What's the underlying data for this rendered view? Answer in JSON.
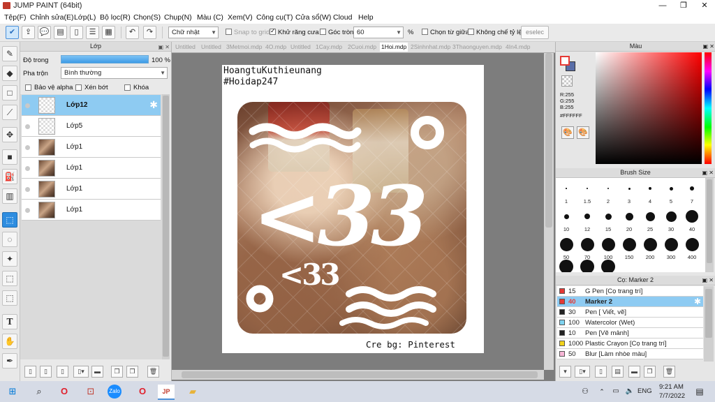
{
  "window": {
    "title": "JUMP PAINT (64bit)",
    "minimize": "—",
    "restore": "❐",
    "close": "✕"
  },
  "menu": [
    "Tệp(F)",
    "Chỉnh sửa(E)",
    "Lớp(L)",
    "Bộ lọc(R)",
    "Chọn(S)",
    "Chụp(N)",
    "Màu (C)",
    "Xem(V)",
    "Công cụ(T)",
    "Cửa sổ(W)",
    "Cloud",
    "Help"
  ],
  "toolbar": {
    "selection_shape": "Chữ nhật",
    "snap_to_grid": "Snap to grid",
    "antialias": "Khử răng cưa",
    "corner_label": "Góc tròn",
    "corner_value": "60",
    "percent": "%",
    "select_center": "Chọn từ giữa",
    "no_ratio": "Không chế tỷ lệ",
    "deselect": "eselec"
  },
  "layer_panel": {
    "title": "Lớp",
    "opacity_label": "Độ trong",
    "opacity_value": "100 %",
    "opacity_fill": 1.0,
    "blend_label": "Pha trộn",
    "blend_value": "Bình thường",
    "protect_alpha": "Bảo vệ alpha",
    "clip": "Xén bớt",
    "lock": "Khóa",
    "layers": [
      {
        "name": "Lớp12",
        "selected": true,
        "thumb": "transparent"
      },
      {
        "name": "Lớp5",
        "selected": false,
        "thumb": "transparent"
      },
      {
        "name": "Lớp1",
        "selected": false,
        "thumb": "image"
      },
      {
        "name": "Lớp1",
        "selected": false,
        "thumb": "image"
      },
      {
        "name": "Lớp1",
        "selected": false,
        "thumb": "image"
      },
      {
        "name": "Lớp1",
        "selected": false,
        "thumb": "image"
      }
    ]
  },
  "tabs": [
    "Untitled",
    "Untitled",
    "3Metmoi.mdp",
    "4O.mdp",
    "Untitled",
    "1Cay.mdp",
    "2Cuoi.mdp",
    "1Hoi.mdp",
    "2Sinhnhat.mdp",
    "3Thaonguyen.mdp",
    "4In4.mdp"
  ],
  "active_tab": 7,
  "canvas": {
    "header_line1": "HoangtuKuthieunang",
    "header_line2": "#Hoidap247",
    "big_text": "<33",
    "small_text": "<33",
    "credit": "Cre bg: Pinterest"
  },
  "color_panel": {
    "title": "Màu",
    "r": "R:255",
    "g": "G:255",
    "b": "B:255",
    "hex": "#FFFFFF",
    "primary_color": "#e53935",
    "secondary_color": "#5a6ea8"
  },
  "brush_panel": {
    "title": "Brush Size",
    "sizes": [
      "1",
      "1.5",
      "2",
      "3",
      "4",
      "5",
      "7",
      "10",
      "12",
      "15",
      "20",
      "25",
      "30",
      "40",
      "50",
      "70",
      "100",
      "150",
      "200",
      "300",
      "400"
    ]
  },
  "marker_panel": {
    "title": "Cọ: Marker 2",
    "items": [
      {
        "size": "15",
        "name": "G Pen [Cọ trang trí]",
        "color": "#e53935",
        "selected": false
      },
      {
        "size": "40",
        "name": "Marker 2",
        "color": "#e53935",
        "selected": true
      },
      {
        "size": "30",
        "name": "Pen [ Viết, vẽ]",
        "color": "#222222",
        "selected": false
      },
      {
        "size": "100",
        "name": "Watercolor (Wet)",
        "color": "#7fd3f0",
        "selected": false
      },
      {
        "size": "10",
        "name": "Pen [Vẽ mảnh]",
        "color": "#222222",
        "selected": false
      },
      {
        "size": "1000",
        "name": "Plastic Crayon [Cọ trang trí]",
        "color": "#f2d21b",
        "selected": false
      },
      {
        "size": "50",
        "name": "Blur [Làm nhòe màu]",
        "color": "#f7b6d6",
        "selected": false
      }
    ]
  },
  "taskbar": {
    "lang": "ENG",
    "time": "9:21 AM",
    "date": "7/7/2022"
  }
}
